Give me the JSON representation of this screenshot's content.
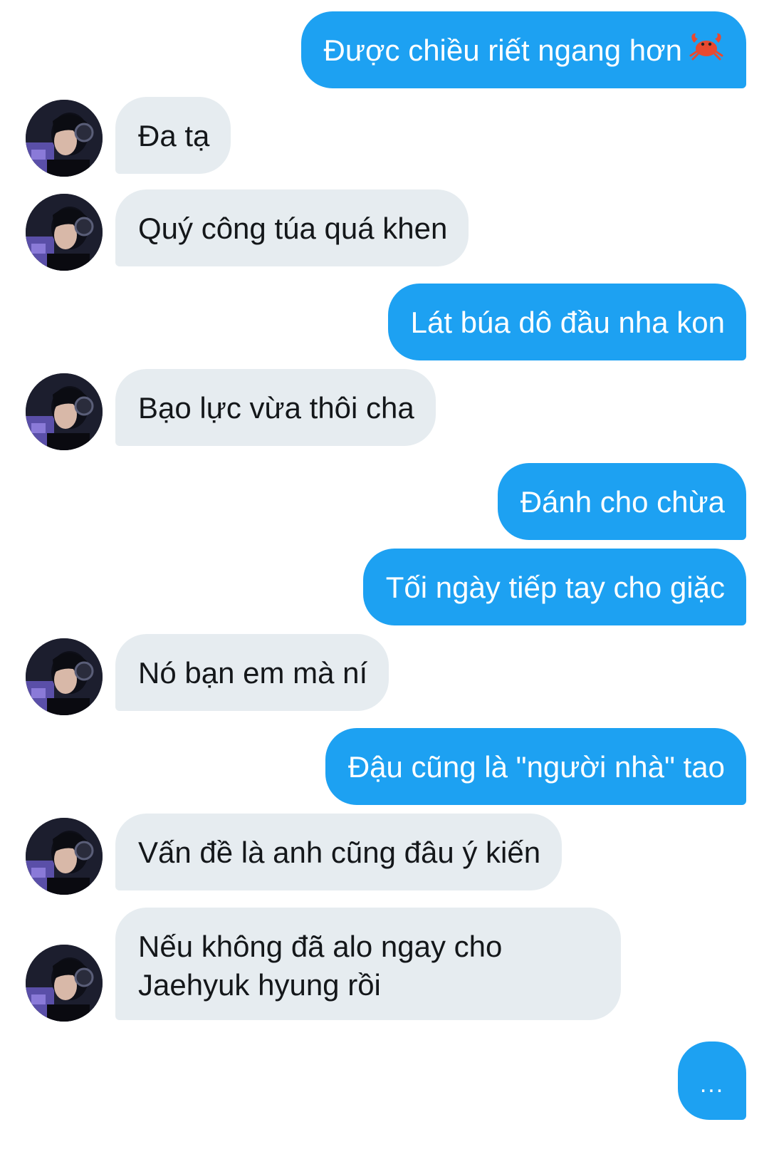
{
  "conversation": {
    "messages": [
      {
        "side": "out",
        "text": "Được chiều riết ngang hơn",
        "emoji": "crab-emoji"
      },
      {
        "side": "in",
        "text": "Đa tạ"
      },
      {
        "side": "in",
        "text": "Quý công túa quá khen"
      },
      {
        "side": "out",
        "text": "Lát búa dô đầu nha kon"
      },
      {
        "side": "in",
        "text": "Bạo lực vừa thôi cha"
      },
      {
        "side": "out",
        "text": "Đánh cho chừa"
      },
      {
        "side": "out",
        "text": "Tối ngày tiếp tay cho giặc"
      },
      {
        "side": "in",
        "text": "Nó bạn em mà ní"
      },
      {
        "side": "out",
        "text": "Đậu cũng là \"người nhà\" tao"
      },
      {
        "side": "in",
        "text": "Vấn đề là anh cũng đâu ý kiến"
      },
      {
        "side": "in",
        "text": "Nếu không đã alo ngay cho Jaehyuk hyung rồi"
      }
    ],
    "typing_indicator": "..."
  },
  "colors": {
    "outgoing_bubble": "#1da1f2",
    "incoming_bubble": "#e6ecf0",
    "incoming_text": "#14171a",
    "outgoing_text": "#ffffff"
  },
  "icons": {
    "avatar": "user-avatar-photo",
    "emoji": "crab-emoji"
  }
}
